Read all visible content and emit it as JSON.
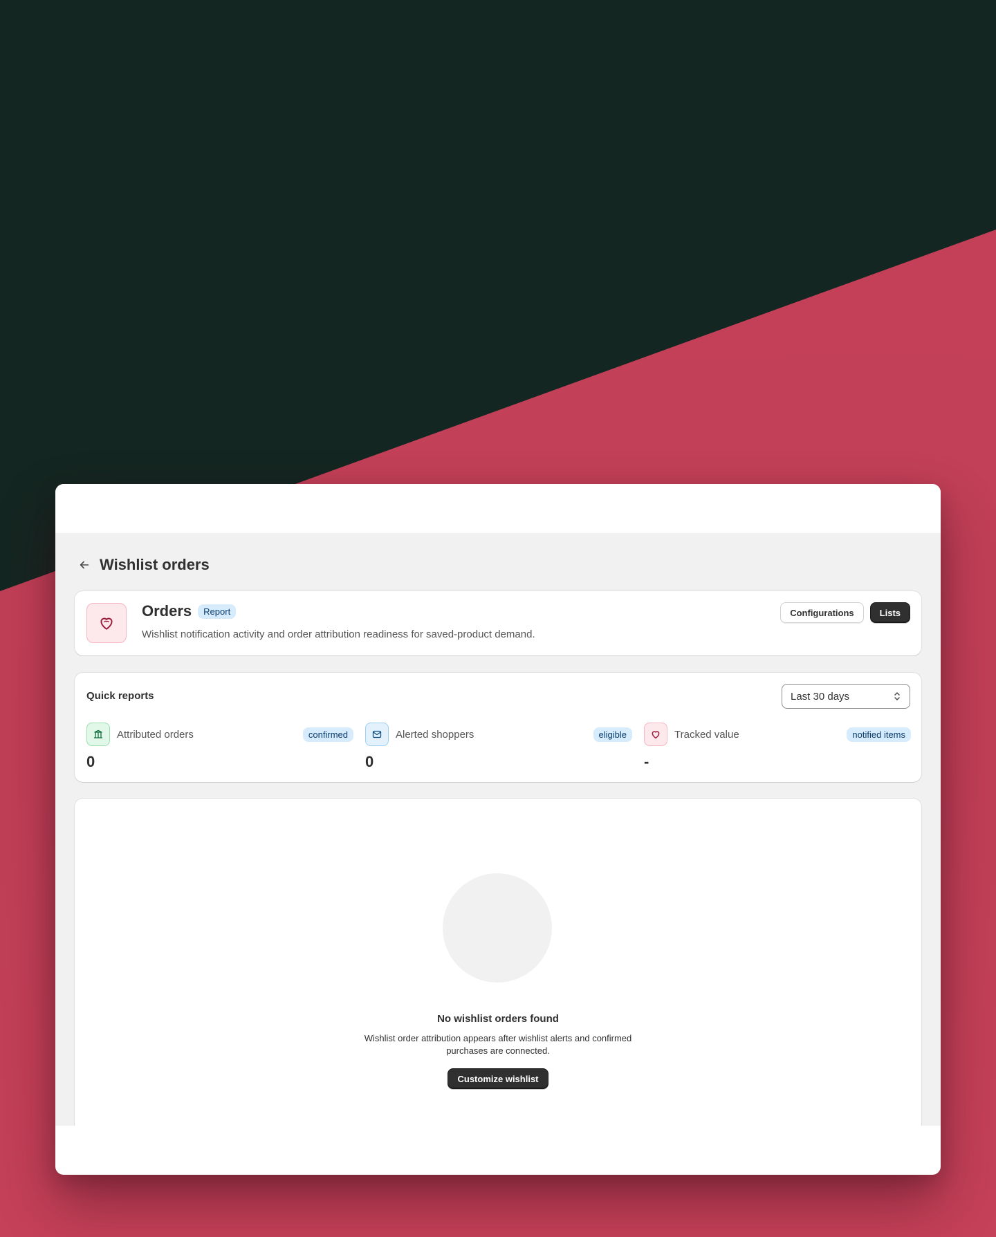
{
  "page": {
    "title": "Wishlist orders"
  },
  "orders_card": {
    "title": "Orders",
    "badge": "Report",
    "description": "Wishlist notification activity and order attribution readiness for saved-product demand.",
    "actions": {
      "configurations": "Configurations",
      "lists": "Lists"
    }
  },
  "quick_reports": {
    "title": "Quick reports",
    "date_range": "Last 30 days",
    "metrics": [
      {
        "label": "Attributed orders",
        "badge": "confirmed",
        "value": "0",
        "icon": "bank-icon"
      },
      {
        "label": "Alerted shoppers",
        "badge": "eligible",
        "value": "0",
        "icon": "email-icon"
      },
      {
        "label": "Tracked value",
        "badge": "notified items",
        "value": "-",
        "icon": "heart-icon"
      }
    ]
  },
  "empty_state": {
    "title": "No wishlist orders found",
    "description": "Wishlist order attribution appears after wishlist alerts and confirmed purchases are connected.",
    "button": "Customize wishlist"
  },
  "colors": {
    "background_dark": "#142621",
    "background_red": "#c54159",
    "primary_button": "#303030",
    "badge_blue": "#d6ebfb"
  }
}
